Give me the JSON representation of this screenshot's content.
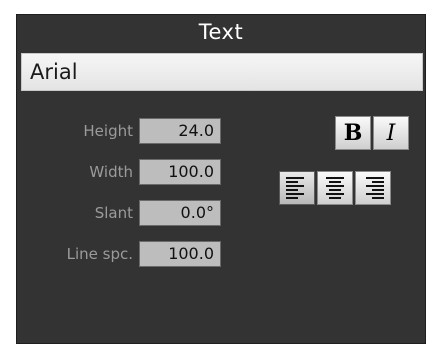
{
  "panel": {
    "title": "Text"
  },
  "font": {
    "value": "Arial"
  },
  "properties": [
    {
      "label": "Height",
      "value": "24.0"
    },
    {
      "label": "Width",
      "value": "100.0"
    },
    {
      "label": "Slant",
      "value": "0.0°"
    },
    {
      "label": "Line spc.",
      "value": "100.0"
    }
  ],
  "style_buttons": {
    "bold": {
      "glyph": "B",
      "icon": "bold-icon"
    },
    "italic": {
      "glyph": "I",
      "icon": "italic-icon"
    }
  },
  "align_buttons": [
    {
      "icon": "align-left-icon",
      "selected": true
    },
    {
      "icon": "align-center-icon",
      "selected": false
    },
    {
      "icon": "align-right-icon",
      "selected": false
    }
  ]
}
